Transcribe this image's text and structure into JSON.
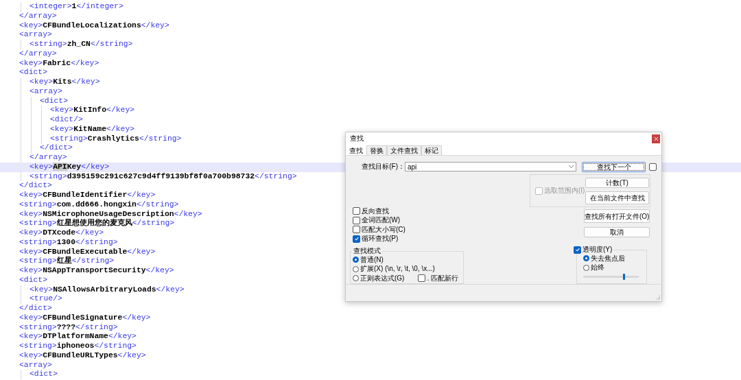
{
  "editor": {
    "lines": [
      {
        "children": [
          {
            "selected": false,
            "parts": [
              {
                "kind": "tag",
                "text": "<integer>"
              },
              {
                "kind": "value",
                "text": "1"
              },
              {
                "kind": "tag",
                "text": "</integer>"
              }
            ]
          }
        ]
      },
      {
        "selected": false,
        "parts": [
          {
            "kind": "tag",
            "text": "</array>"
          }
        ]
      },
      {
        "selected": false,
        "parts": [
          {
            "kind": "tag",
            "text": "<key>"
          },
          {
            "kind": "value",
            "text": "CFBundleLocalizations"
          },
          {
            "kind": "tag",
            "text": "</key>"
          }
        ]
      },
      {
        "selected": false,
        "parts": [
          {
            "kind": "tag",
            "text": "<array>"
          }
        ],
        "children": [
          {
            "selected": false,
            "parts": [
              {
                "kind": "tag",
                "text": "<string>"
              },
              {
                "kind": "value",
                "text": "zh_CN"
              },
              {
                "kind": "tag",
                "text": "</string>"
              }
            ]
          }
        ]
      },
      {
        "selected": false,
        "parts": [
          {
            "kind": "tag",
            "text": "</array>"
          }
        ]
      },
      {
        "selected": false,
        "parts": [
          {
            "kind": "tag",
            "text": "<key>"
          },
          {
            "kind": "value",
            "text": "Fabric"
          },
          {
            "kind": "tag",
            "text": "</key>"
          }
        ]
      },
      {
        "selected": false,
        "parts": [
          {
            "kind": "tag",
            "text": "<dict>"
          }
        ],
        "children": [
          {
            "selected": false,
            "parts": [
              {
                "kind": "tag",
                "text": "<key>"
              },
              {
                "kind": "value",
                "text": "Kits"
              },
              {
                "kind": "tag",
                "text": "</key>"
              }
            ]
          },
          {
            "selected": false,
            "parts": [
              {
                "kind": "tag",
                "text": "<array>"
              }
            ],
            "children": [
              {
                "selected": false,
                "parts": [
                  {
                    "kind": "tag",
                    "text": "<dict>"
                  }
                ],
                "children": [
                  {
                    "selected": false,
                    "parts": [
                      {
                        "kind": "tag",
                        "text": "<key>"
                      },
                      {
                        "kind": "value",
                        "text": "KitInfo"
                      },
                      {
                        "kind": "tag",
                        "text": "</key>"
                      }
                    ]
                  },
                  {
                    "selected": false,
                    "parts": [
                      {
                        "kind": "tag",
                        "text": "<dict/>"
                      }
                    ]
                  },
                  {
                    "selected": false,
                    "parts": [
                      {
                        "kind": "tag",
                        "text": "<key>"
                      },
                      {
                        "kind": "value",
                        "text": "KitName"
                      },
                      {
                        "kind": "tag",
                        "text": "</key>"
                      }
                    ]
                  },
                  {
                    "selected": false,
                    "parts": [
                      {
                        "kind": "tag",
                        "text": "<string>"
                      },
                      {
                        "kind": "value",
                        "text": "Crashlytics"
                      },
                      {
                        "kind": "tag",
                        "text": "</string>"
                      }
                    ]
                  }
                ]
              },
              {
                "selected": false,
                "parts": [
                  {
                    "kind": "tag",
                    "text": "</dict>"
                  }
                ]
              }
            ]
          },
          {
            "selected": false,
            "parts": [
              {
                "kind": "tag",
                "text": "</array>"
              }
            ]
          },
          {
            "selected": true,
            "parts": [
              {
                "kind": "tag",
                "text": "<key>"
              },
              {
                "kind": "match",
                "text": "API"
              },
              {
                "kind": "value",
                "text": "Key"
              },
              {
                "kind": "tag",
                "text": "</key>"
              }
            ]
          },
          {
            "selected": false,
            "parts": [
              {
                "kind": "tag",
                "text": "<string>"
              },
              {
                "kind": "value",
                "text": "d395159c291c627c9d4ff9139bf8f0a700b98732"
              },
              {
                "kind": "tag",
                "text": "</string>"
              }
            ]
          }
        ]
      },
      {
        "selected": false,
        "parts": [
          {
            "kind": "tag",
            "text": "</dict>"
          }
        ]
      },
      {
        "selected": false,
        "parts": [
          {
            "kind": "tag",
            "text": "<key>"
          },
          {
            "kind": "value",
            "text": "CFBundleIdentifier"
          },
          {
            "kind": "tag",
            "text": "</key>"
          }
        ]
      },
      {
        "selected": false,
        "parts": [
          {
            "kind": "tag",
            "text": "<string>"
          },
          {
            "kind": "value",
            "text": "com.dd666.hongxin"
          },
          {
            "kind": "tag",
            "text": "</string>"
          }
        ]
      },
      {
        "selected": false,
        "parts": [
          {
            "kind": "tag",
            "text": "<key>"
          },
          {
            "kind": "value",
            "text": "NSMicrophoneUsageDescription"
          },
          {
            "kind": "tag",
            "text": "</key>"
          }
        ]
      },
      {
        "selected": false,
        "parts": [
          {
            "kind": "tag",
            "text": "<string>"
          },
          {
            "kind": "value",
            "text": "红星想使用您的麦克风"
          },
          {
            "kind": "tag",
            "text": "</string>"
          }
        ]
      },
      {
        "selected": false,
        "parts": [
          {
            "kind": "tag",
            "text": "<key>"
          },
          {
            "kind": "value",
            "text": "DTXcode"
          },
          {
            "kind": "tag",
            "text": "</key>"
          }
        ]
      },
      {
        "selected": false,
        "parts": [
          {
            "kind": "tag",
            "text": "<string>"
          },
          {
            "kind": "value",
            "text": "1300"
          },
          {
            "kind": "tag",
            "text": "</string>"
          }
        ]
      },
      {
        "selected": false,
        "parts": [
          {
            "kind": "tag",
            "text": "<key>"
          },
          {
            "kind": "value",
            "text": "CFBundleExecutable"
          },
          {
            "kind": "tag",
            "text": "</key>"
          }
        ]
      },
      {
        "selected": false,
        "parts": [
          {
            "kind": "tag",
            "text": "<string>"
          },
          {
            "kind": "value",
            "text": "红星"
          },
          {
            "kind": "tag",
            "text": "</string>"
          }
        ]
      },
      {
        "selected": false,
        "parts": [
          {
            "kind": "tag",
            "text": "<key>"
          },
          {
            "kind": "value",
            "text": "NSAppTransportSecurity"
          },
          {
            "kind": "tag",
            "text": "</key>"
          }
        ]
      },
      {
        "selected": false,
        "parts": [
          {
            "kind": "tag",
            "text": "<dict>"
          }
        ],
        "children": [
          {
            "selected": false,
            "parts": [
              {
                "kind": "tag",
                "text": "<key>"
              },
              {
                "kind": "value",
                "text": "NSAllowsArbitraryLoads"
              },
              {
                "kind": "tag",
                "text": "</key>"
              }
            ]
          },
          {
            "selected": false,
            "parts": [
              {
                "kind": "tag",
                "text": "<true/>"
              }
            ]
          }
        ]
      },
      {
        "selected": false,
        "parts": [
          {
            "kind": "tag",
            "text": "</dict>"
          }
        ]
      },
      {
        "selected": false,
        "parts": [
          {
            "kind": "tag",
            "text": "<key>"
          },
          {
            "kind": "value",
            "text": "CFBundleSignature"
          },
          {
            "kind": "tag",
            "text": "</key>"
          }
        ]
      },
      {
        "selected": false,
        "parts": [
          {
            "kind": "tag",
            "text": "<string>"
          },
          {
            "kind": "value",
            "text": "????"
          },
          {
            "kind": "tag",
            "text": "</string>"
          }
        ]
      },
      {
        "selected": false,
        "parts": [
          {
            "kind": "tag",
            "text": "<key>"
          },
          {
            "kind": "value",
            "text": "DTPlatformName"
          },
          {
            "kind": "tag",
            "text": "</key>"
          }
        ]
      },
      {
        "selected": false,
        "parts": [
          {
            "kind": "tag",
            "text": "<string>"
          },
          {
            "kind": "value",
            "text": "iphoneos"
          },
          {
            "kind": "tag",
            "text": "</string>"
          }
        ]
      },
      {
        "selected": false,
        "parts": [
          {
            "kind": "tag",
            "text": "<key>"
          },
          {
            "kind": "value",
            "text": "CFBundleURLTypes"
          },
          {
            "kind": "tag",
            "text": "</key>"
          }
        ]
      },
      {
        "selected": false,
        "parts": [
          {
            "kind": "tag",
            "text": "<array>"
          }
        ],
        "children": [
          {
            "selected": false,
            "parts": [
              {
                "kind": "tag",
                "text": "<dict>"
              }
            ]
          }
        ]
      }
    ]
  },
  "find_dialog": {
    "title": "查找",
    "tabs": [
      {
        "label": "查找",
        "selected": true
      },
      {
        "label": "替换",
        "selected": false
      },
      {
        "label": "文件查找",
        "selected": false
      },
      {
        "label": "标记",
        "selected": false
      }
    ],
    "find_field": {
      "label": "查找目标(F)：",
      "value": "api"
    },
    "find_next_button": "查找下一个",
    "side_checkbox": {
      "checked": false
    },
    "in_selection": {
      "label": "选取范围内(I)",
      "checked": false,
      "disabled": true
    },
    "selection_buttons": [
      "计数(T)",
      "在当前文件中查找"
    ],
    "options": [
      {
        "label": "反向查找",
        "checked": false
      },
      {
        "label": "全词匹配(W)",
        "checked": false
      },
      {
        "label": "匹配大小写(C)",
        "checked": false
      },
      {
        "label": "循环查找(P)",
        "checked": true
      }
    ],
    "side_buttons": [
      "查找所有打开文件(O)",
      "取消"
    ],
    "search_mode": {
      "title": "查找模式",
      "modes": [
        {
          "label": "普通(N)",
          "selected": true
        },
        {
          "label": "扩展(X) (\\n, \\r, \\t, \\0, \\x...)",
          "selected": false
        },
        {
          "label": "正则表达式(G)",
          "selected": false
        }
      ],
      "dot_newline": {
        "label": ". 匹配新行",
        "checked": false
      }
    },
    "transparency": {
      "label": "透明度(Y)",
      "checked": true,
      "modes": [
        {
          "label": "失去焦点后",
          "selected": true
        },
        {
          "label": "始终",
          "selected": false
        }
      ],
      "level": 0.72
    }
  }
}
